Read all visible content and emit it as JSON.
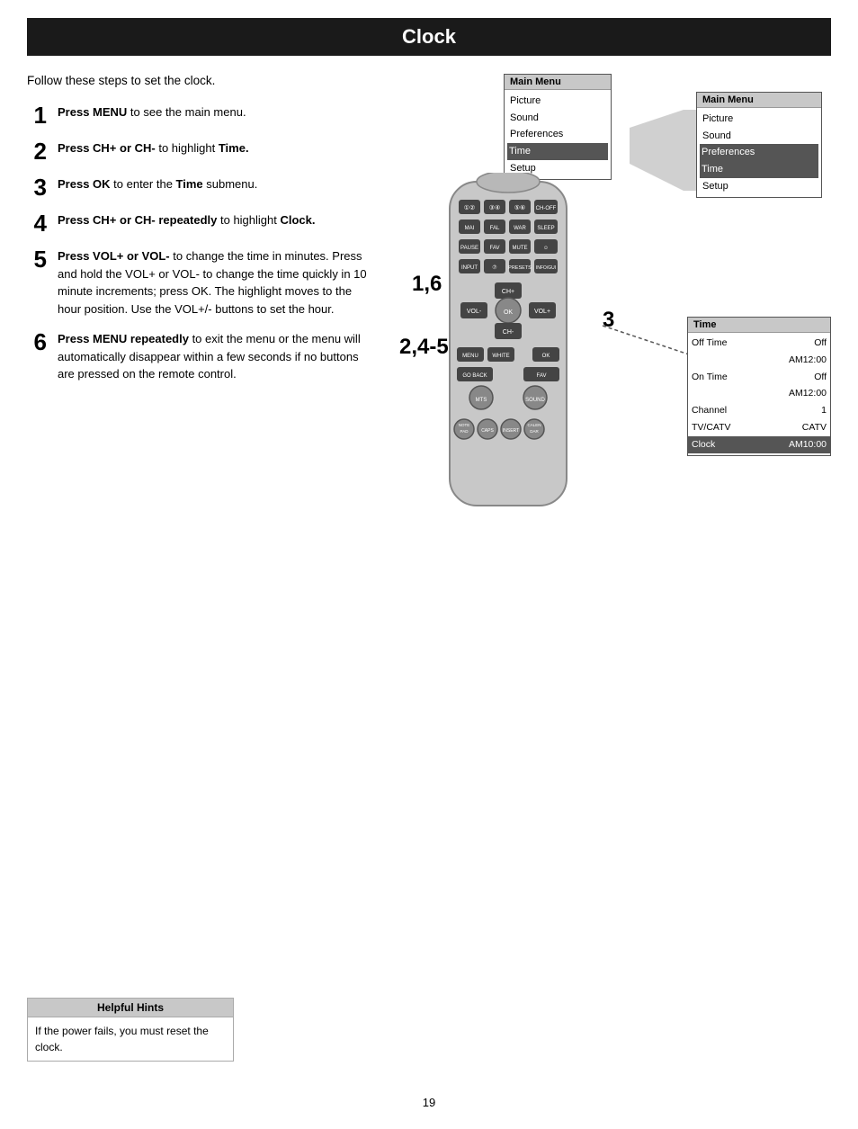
{
  "page": {
    "title": "Clock",
    "page_number": "19"
  },
  "intro": {
    "text": "Follow these steps to set the clock."
  },
  "steps": [
    {
      "number": "1",
      "text_parts": [
        {
          "bold": true,
          "text": "Press MENU"
        },
        {
          "bold": false,
          "text": " to see the main menu."
        }
      ]
    },
    {
      "number": "2",
      "text_parts": [
        {
          "bold": true,
          "text": "Press CH+ or CH-"
        },
        {
          "bold": false,
          "text": " to highlight "
        },
        {
          "bold": true,
          "text": "Time."
        }
      ]
    },
    {
      "number": "3",
      "text_parts": [
        {
          "bold": true,
          "text": "Press OK"
        },
        {
          "bold": false,
          "text": " to enter the "
        },
        {
          "bold": true,
          "text": "Time"
        },
        {
          "bold": false,
          "text": " submenu."
        }
      ]
    },
    {
      "number": "4",
      "text_parts": [
        {
          "bold": true,
          "text": "Press CH+ or CH- repeatedly"
        },
        {
          "bold": false,
          "text": " to highlight "
        },
        {
          "bold": true,
          "text": "Clock."
        }
      ]
    },
    {
      "number": "5",
      "text_parts": [
        {
          "bold": true,
          "text": "Press VOL+ or VOL-"
        },
        {
          "bold": false,
          "text": " to change the time in minutes. Press and hold the VOL+ or VOL- to change the time quickly in 10 minute increments; press OK. The highlight moves to the hour position. Use the VOL+/- buttons to set the hour."
        }
      ]
    },
    {
      "number": "6",
      "text_parts": [
        {
          "bold": true,
          "text": "Press MENU repeatedly"
        },
        {
          "bold": false,
          "text": " to exit the menu or the menu will automatically disappear within a few seconds if no buttons are pressed on the remote control."
        }
      ]
    }
  ],
  "menus": {
    "main_menu_1": {
      "header": "Main Menu",
      "items": [
        "Picture",
        "Sound",
        "Preferences",
        "Time",
        "Setup"
      ],
      "highlighted": "Time"
    },
    "main_menu_2": {
      "header": "Main Menu",
      "items": [
        "Picture",
        "Sound",
        "Preferences",
        "Time",
        "Setup"
      ],
      "highlighted": "Time"
    },
    "time_menu": {
      "header": "Time",
      "rows": [
        {
          "label": "Off Time",
          "value": "Off"
        },
        {
          "label": "",
          "value": "AM12:00"
        },
        {
          "label": "On Time",
          "value": "Off"
        },
        {
          "label": "",
          "value": "AM12:00"
        },
        {
          "label": "Channel",
          "value": "1"
        },
        {
          "label": "TV/CATV",
          "value": "CATV"
        },
        {
          "label": "Clock",
          "value": "AM10:00"
        }
      ],
      "highlighted": "Clock"
    }
  },
  "step_labels": {
    "label_16": "1,6",
    "label_245": "2,4-5",
    "label_3": "3"
  },
  "hints": {
    "header": "Helpful Hints",
    "text": "If the power fails, you must reset the clock."
  },
  "remote": {
    "buttons": {
      "row1": [
        "① ②",
        "③ ④",
        "⑤ ⑥",
        "CH-OFF"
      ],
      "row2": [
        "MAI",
        "FAL",
        "WAR",
        "SLEEP"
      ],
      "row3": [
        "PAUSE",
        "FAV",
        "MUTE",
        "☺"
      ],
      "row4": [
        "INPUT",
        "⑦",
        "PRESETS",
        "INFO/GUI"
      ],
      "nav": {
        "up": "CH+",
        "down": "CH-",
        "left": "VOL-",
        "right": "VOL+",
        "center": "OK"
      },
      "row5": [
        "MENU",
        "WHITE",
        "OK"
      ],
      "row6": [
        "GO BACK",
        "",
        "FAV"
      ],
      "row7": [
        "MTS",
        "SOUND"
      ],
      "row8": [
        "NOTEPAD",
        "CAPS",
        "INSERT",
        "CALENDAR"
      ]
    }
  }
}
